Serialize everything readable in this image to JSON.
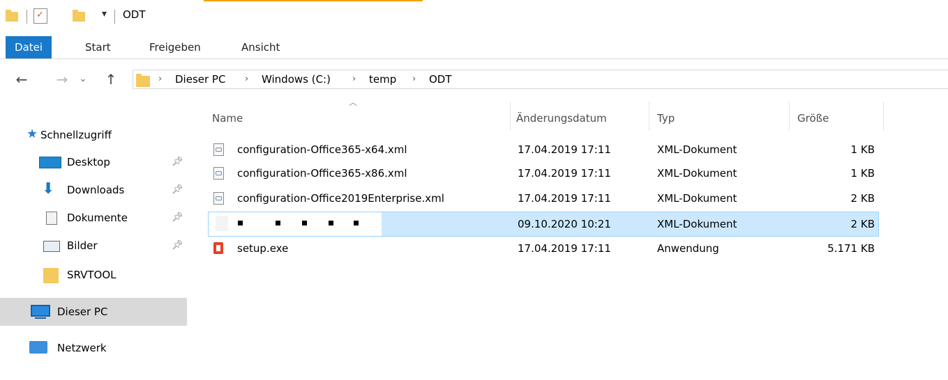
{
  "window": {
    "title": "ODT"
  },
  "qat": {
    "dropdown_glyph": "▾"
  },
  "ribbon": {
    "tabs": [
      "Datei",
      "Start",
      "Freigeben",
      "Ansicht"
    ]
  },
  "address": {
    "crumbs": [
      "Dieser PC",
      "Windows (C:)",
      "temp",
      "ODT"
    ]
  },
  "sidebar": {
    "quick_access": "Schnellzugriff",
    "items": [
      {
        "label": "Desktop",
        "icon": "desktop-icon",
        "pinned": true
      },
      {
        "label": "Downloads",
        "icon": "downloads-icon",
        "pinned": true
      },
      {
        "label": "Dokumente",
        "icon": "documents-icon",
        "pinned": true
      },
      {
        "label": "Bilder",
        "icon": "pictures-icon",
        "pinned": true
      },
      {
        "label": "SRVTOOL",
        "icon": "folder-icon",
        "pinned": false
      }
    ],
    "this_pc": "Dieser PC",
    "network": "Netzwerk"
  },
  "columns": {
    "name": "Name",
    "date": "Änderungsdatum",
    "type": "Typ",
    "size": "Größe"
  },
  "files": [
    {
      "name": "configuration-Office365-x64.xml",
      "date": "17.04.2019 17:11",
      "type": "XML-Dokument",
      "size": "1 KB"
    },
    {
      "name": "configuration-Office365-x86.xml",
      "date": "17.04.2019 17:11",
      "type": "XML-Dokument",
      "size": "1 KB"
    },
    {
      "name": "configuration-Office2019Enterprise.xml",
      "date": "17.04.2019 17:11",
      "type": "XML-Dokument",
      "size": "2 KB"
    },
    {
      "name": "",
      "date": "09.10.2020 10:21",
      "type": "XML-Dokument",
      "size": "2 KB",
      "selected": true,
      "redacted": true
    },
    {
      "name": "setup.exe",
      "date": "17.04.2019 17:11",
      "type": "Anwendung",
      "size": "5.171 KB"
    }
  ],
  "colors": {
    "accent": "#1979ca",
    "selection": "#cce8ff",
    "selection_border": "#99d1ff",
    "folder": "#f4c95d",
    "office_red": "#e74025"
  }
}
